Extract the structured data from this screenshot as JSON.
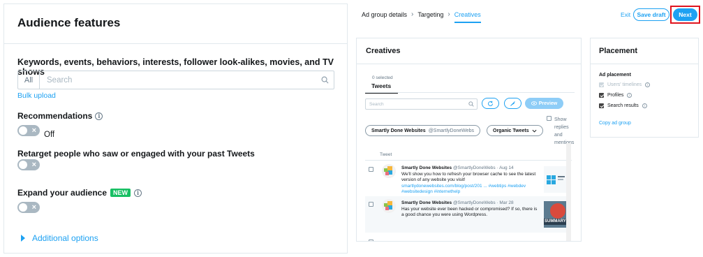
{
  "audience": {
    "title": "Audience features",
    "keywords_heading": "Keywords, events, behaviors, interests, follower look-alikes, movies, and TV shows",
    "filter_all": "All",
    "search_placeholder": "Search",
    "bulk_upload": "Bulk upload",
    "recommendations_label": "Recommendations",
    "recommendations_state": "Off",
    "retarget_label": "Retarget people who saw or engaged with your past Tweets",
    "expand_label": "Expand your audience",
    "new_badge": "NEW",
    "additional_options": "Additional options"
  },
  "topbar": {
    "breadcrumb": [
      "Ad group details",
      "Targeting",
      "Creatives"
    ],
    "exit": "Exit",
    "save_draft": "Save draft",
    "next": "Next"
  },
  "creatives": {
    "title": "Creatives",
    "selected_count": "0 selected",
    "tab": "Tweets",
    "search_placeholder": "Search",
    "preview": "Preview",
    "show_replies": "Show replies and mentions",
    "account_name": "Smartly Done Websites",
    "account_handle": "@SmartlyDoneWebs",
    "organic_filter": "Organic Tweets",
    "column_tweet": "Tweet",
    "tweets": [
      {
        "name": "Smartly Done Websites",
        "handle": "@SmartlyDoneWebs",
        "date": "Aug 14",
        "text": "We'll show you how to refresh your browser cache to see the latest version of any website you visit!",
        "link": "smartlydonewebsites.com/blog/post/201",
        "ellipsis": "...",
        "hashtags": "#webtips #webdev #websitedesign #internethelp"
      },
      {
        "name": "Smartly Done Websites",
        "handle": "@SmartlyDoneWebs",
        "date": "Mar 28",
        "text": "Has your website ever been hacked or compromised? If so, there is a good chance you were using Wordpress.",
        "thumb_label": "SUMMARY"
      }
    ]
  },
  "placement": {
    "title": "Placement",
    "subtitle": "Ad placement",
    "items": [
      "Users' timelines",
      "Profiles",
      "Search results"
    ],
    "copy_link": "Copy ad group"
  },
  "colors": {
    "accent": "#1da1f2",
    "highlight": "#e0141e",
    "badge": "#17bf63"
  }
}
